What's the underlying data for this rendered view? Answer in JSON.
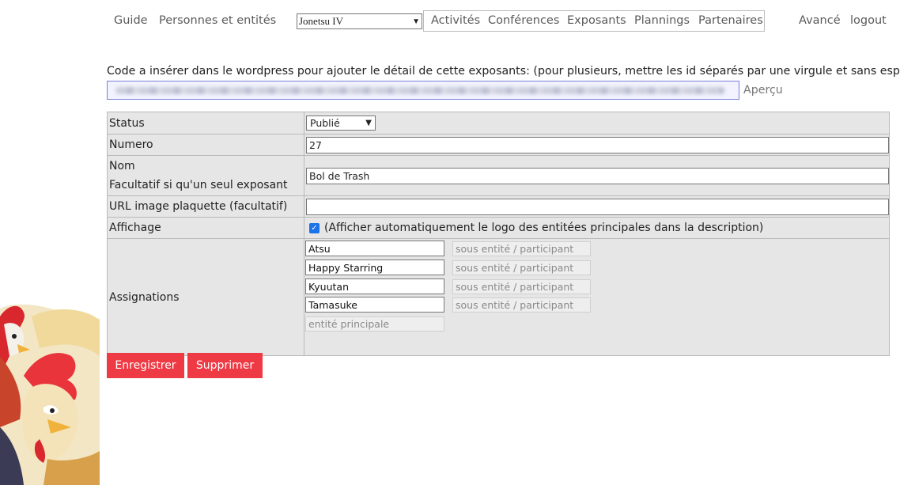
{
  "nav": {
    "guide": "Guide",
    "personnes": "Personnes et entités",
    "event_selected": "Jonetsu IV",
    "activites": "Activités",
    "conferences": "Conférences",
    "exposants": "Exposants",
    "plannings": "Plannings",
    "partenaires": "Partenaires",
    "avance": "Avancé",
    "logout": "logout"
  },
  "code": {
    "label": "Code a insérer dans le wordpress pour ajouter le détail de cette exposants: (pour plusieurs, mettre les id séparés par une virgule et sans espaces)",
    "apercu": "Aperçu"
  },
  "form": {
    "status_label": "Status",
    "status_value": "Publié",
    "numero_label": "Numero",
    "numero_value": "27",
    "nom_label": "Nom",
    "nom_hint": "Facultatif si qu'un seul exposant",
    "nom_value": "Bol de Trash",
    "url_label": "URL image plaquette (facultatif)",
    "url_value": "",
    "affichage_label": "Affichage",
    "affichage_text": "(Afficher automatiquement le logo des entitées principales dans la description)",
    "affichage_checked": true,
    "assignations_label": "Assignations",
    "assignations": [
      {
        "value": "Atsu",
        "sub_placeholder": "sous entité / participant"
      },
      {
        "value": "Happy Starring",
        "sub_placeholder": "sous entité / participant"
      },
      {
        "value": "Kyuutan",
        "sub_placeholder": "sous entité / participant"
      },
      {
        "value": "Tamasuke",
        "sub_placeholder": "sous entité / participant"
      }
    ],
    "new_placeholder": "entité principale"
  },
  "buttons": {
    "save": "Enregistrer",
    "delete": "Supprimer"
  },
  "colors": {
    "button": "#ee3a44",
    "table_bg": "#e6e6e6",
    "checkbox": "#1a73e8"
  }
}
